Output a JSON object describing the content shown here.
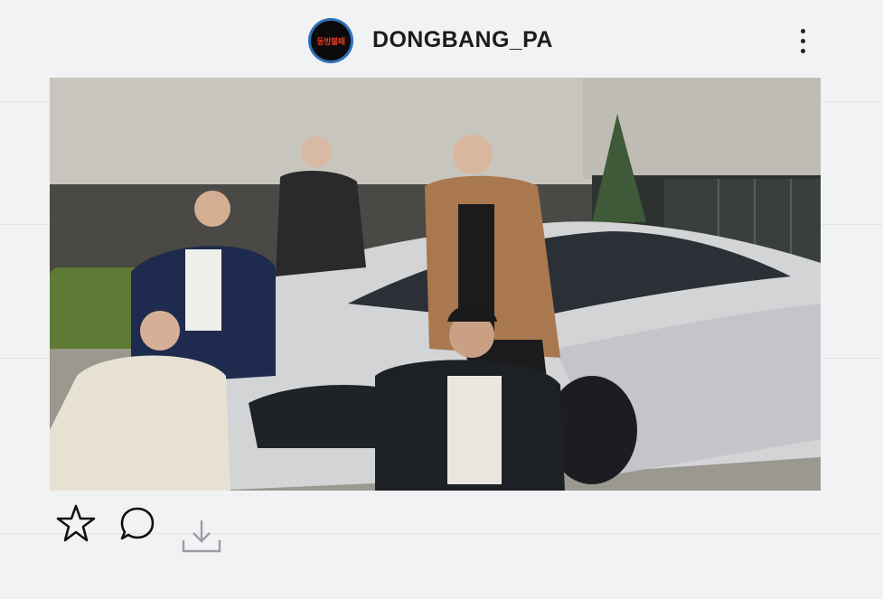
{
  "post": {
    "username": "DONGBANG_PA",
    "avatar_logo_text": "동방불패",
    "image_alt": "Five people posing around a silver sports car in front of a concrete building"
  },
  "actions": {
    "like_icon": "star-icon",
    "comment_icon": "comment-icon",
    "download_icon": "download-icon"
  },
  "colors": {
    "avatar_ring": "#2f6fb6",
    "background": "#f1f2f4",
    "text": "#1c1c1c"
  }
}
